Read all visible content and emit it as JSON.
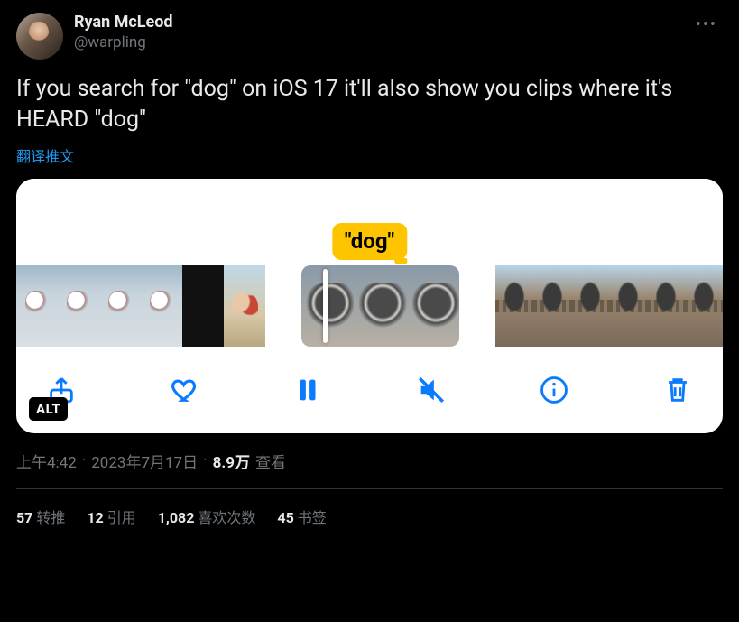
{
  "author": {
    "display_name": "Ryan McLeod",
    "handle": "@warpling"
  },
  "body_text": "If you search for \"dog\" on iOS 17 it'll also show you clips where it's HEARD \"dog\"",
  "translate_label": "翻译推文",
  "media": {
    "tooltip_text": "\"dog\"",
    "alt_badge": "ALT"
  },
  "meta": {
    "time": "上午4:42",
    "date": "2023年7月17日",
    "views_count": "8.9万",
    "views_label": "查看"
  },
  "stats": {
    "retweets_count": "57",
    "retweets_label": "转推",
    "quotes_count": "12",
    "quotes_label": "引用",
    "likes_count": "1,082",
    "likes_label": "喜欢次数",
    "bookmarks_count": "45",
    "bookmarks_label": "书签"
  }
}
